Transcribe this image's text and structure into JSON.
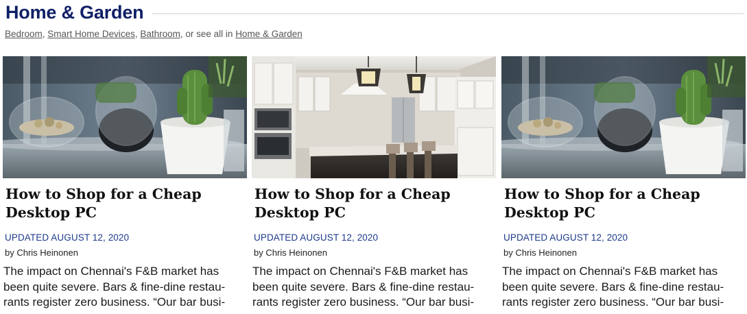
{
  "section": {
    "title": "Home & Garden",
    "subnav": {
      "links": [
        "Bedroom",
        "Smart Home Devices",
        "Bathroom"
      ],
      "see_all_prefix": ", or see all in ",
      "see_all_link": "Home & Garden"
    }
  },
  "cards": [
    {
      "image": "cactus-planter-photo",
      "headline": "How to Shop for a Cheap Desktop PC",
      "updated": "UPDATED AUGUST 12, 2020",
      "byline": "by Chris Heinonen",
      "excerpt_lines": [
        "The impact on Chennai's F&B market has",
        "been quite severe. Bars & fine-dine restau-",
        "rants register zero business. “Our bar busi-"
      ]
    },
    {
      "image": "kitchen-island-photo",
      "headline": "How to Shop for a Cheap Desktop PC",
      "updated": "UPDATED AUGUST 12, 2020",
      "byline": "by Chris Heinonen",
      "excerpt_lines": [
        "The impact on Chennai's F&B market has",
        "been quite severe. Bars & fine-dine restau-",
        "rants register zero business. “Our bar busi-"
      ]
    },
    {
      "image": "cactus-planter-photo",
      "headline": "How to Shop for a Cheap Desktop PC",
      "updated": "UPDATED AUGUST 12, 2020",
      "byline": "by Chris Heinonen",
      "excerpt_lines": [
        "The impact on Chennai's F&B market has",
        "been quite severe. Bars & fine-dine restau-",
        "rants register zero business. “Our bar busi-"
      ]
    }
  ],
  "colors": {
    "title": "#0f1f66",
    "updated": "#1d3a8a",
    "rule": "#e6e6ea"
  }
}
